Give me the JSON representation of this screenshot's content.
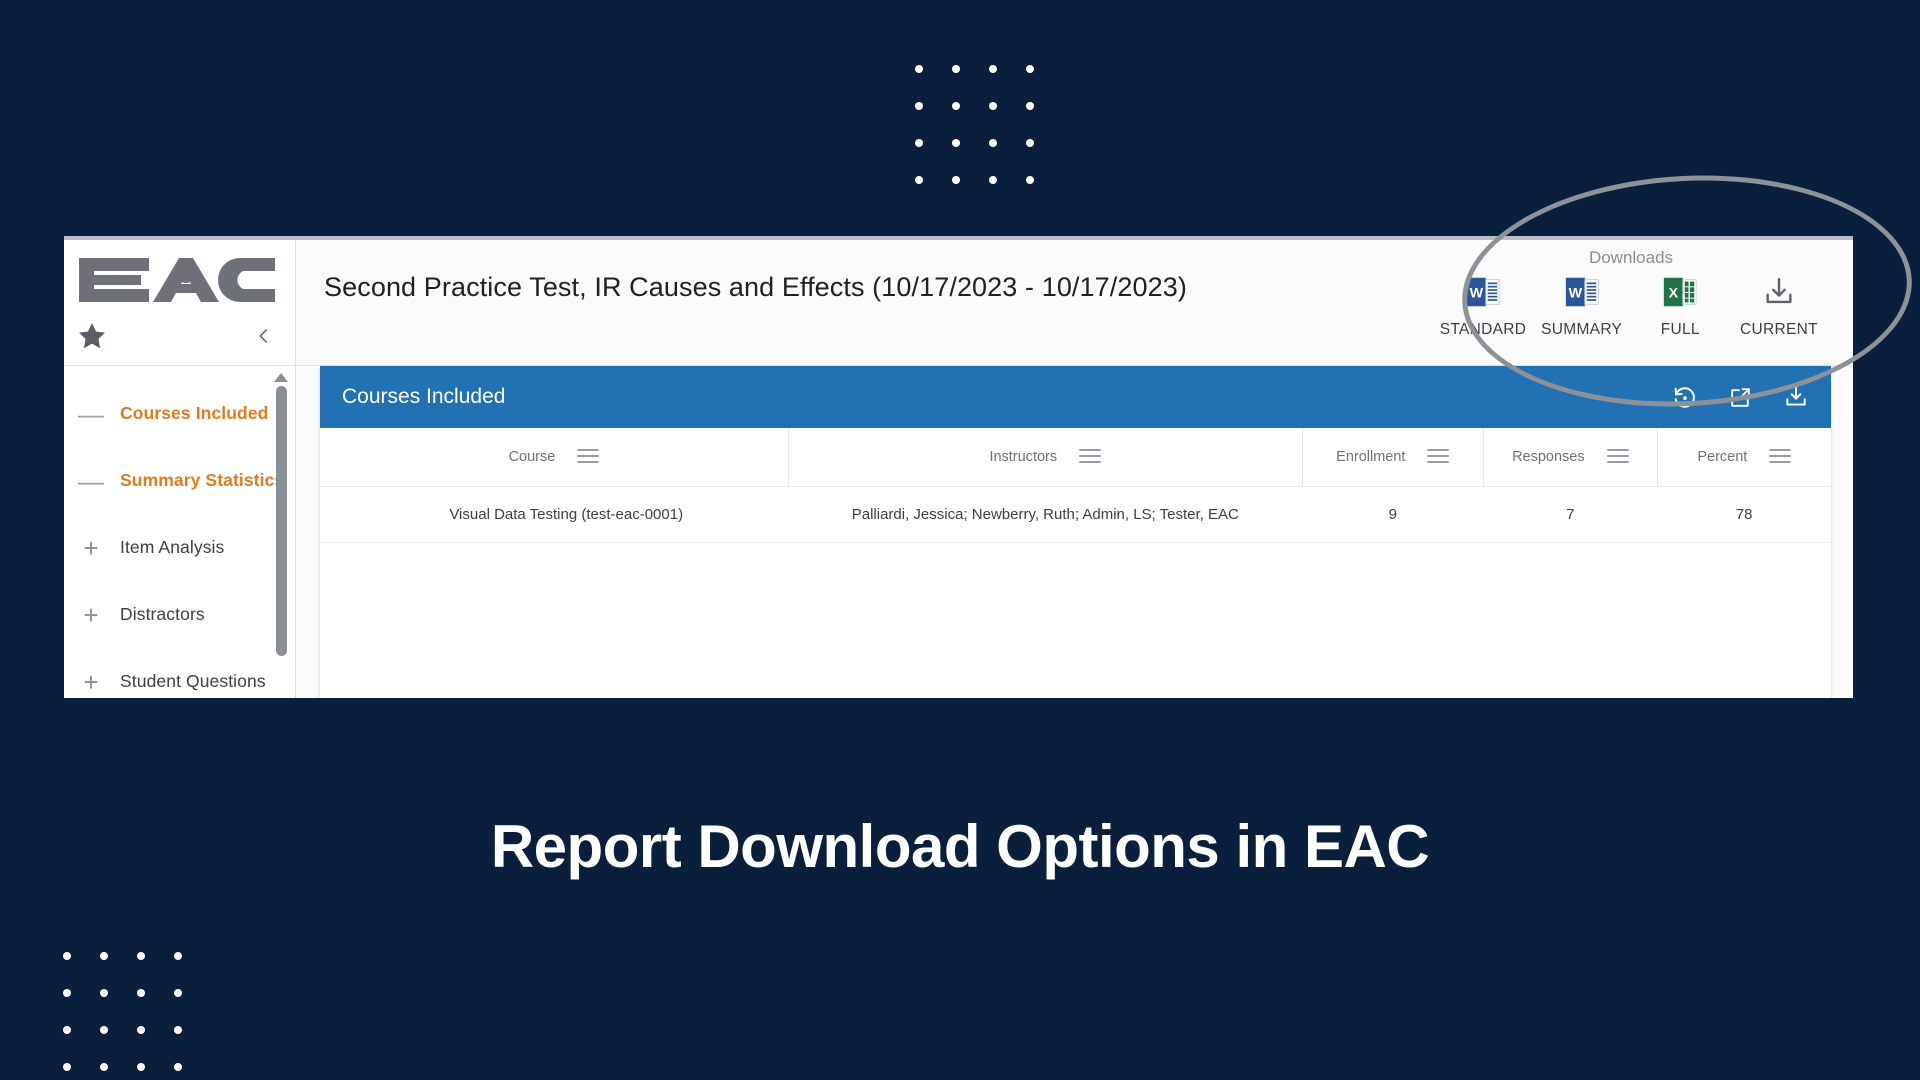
{
  "slide": {
    "caption": "Report Download Options in EAC",
    "background_color": "#0a1f3c",
    "accent_color": "#e07a1f",
    "panel_color": "#2271b3"
  },
  "decor": {
    "dot_color": "#ffffff",
    "dot_rows": 4,
    "dot_cols": 4
  },
  "app": {
    "brand": {
      "logo_text": "EAC",
      "star_icon": "star-icon",
      "collapse_icon": "chevron-left-icon"
    },
    "sidebar": {
      "items": [
        {
          "label": "Courses Included",
          "state": "expanded",
          "toggle": "—"
        },
        {
          "label": "Summary Statistics",
          "state": "expanded",
          "toggle": "—"
        },
        {
          "label": "Item Analysis",
          "state": "collapsed",
          "toggle": "+"
        },
        {
          "label": "Distractors",
          "state": "collapsed",
          "toggle": "+"
        },
        {
          "label": "Student Questions",
          "state": "collapsed",
          "toggle": "+"
        }
      ]
    },
    "header": {
      "report_title": "Second Practice Test, IR Causes and Effects (10/17/2023 - 10/17/2023)",
      "downloads_label": "Downloads",
      "download_options": [
        {
          "caption": "STANDARD",
          "icon": "word-doc-icon",
          "color": "#2b579a"
        },
        {
          "caption": "SUMMARY",
          "icon": "word-doc-icon",
          "color": "#2b579a"
        },
        {
          "caption": "FULL",
          "icon": "excel-sheet-icon",
          "color": "#217346"
        },
        {
          "caption": "CURRENT",
          "icon": "download-icon",
          "color": "#5f6368"
        }
      ]
    },
    "panel": {
      "title": "Courses Included",
      "actions": [
        {
          "name": "restore-icon"
        },
        {
          "name": "open-in-new-icon"
        },
        {
          "name": "download-icon"
        }
      ],
      "table": {
        "columns": [
          "Course",
          "Instructors",
          "Enrollment",
          "Responses",
          "Percent"
        ],
        "rows": [
          {
            "course": "Visual Data Testing (test-eac-0001)",
            "instructors": "Palliardi, Jessica; Newberry, Ruth; Admin, LS; Tester, EAC",
            "enrollment": "9",
            "responses": "7",
            "percent": "78"
          }
        ]
      }
    }
  }
}
